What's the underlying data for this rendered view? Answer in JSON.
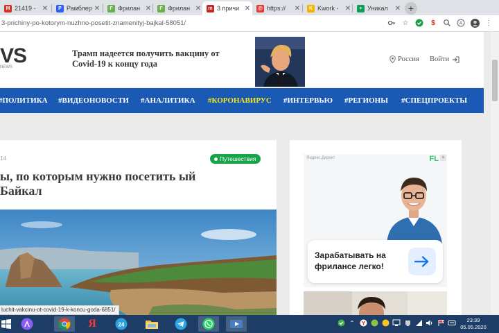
{
  "browser": {
    "tabs": [
      {
        "title": "21419 -",
        "favicon": "gmail-icon",
        "color": "#d93025",
        "active": false
      },
      {
        "title": "Рамблер",
        "favicon": "rambler-icon",
        "color": "#315efb",
        "active": false
      },
      {
        "title": "Фрилан",
        "favicon": "freelance-icon",
        "color": "#6ab04c",
        "active": false
      },
      {
        "title": "Фрилан",
        "favicon": "freelance-icon",
        "color": "#6ab04c",
        "active": false
      },
      {
        "title": "3 причи",
        "favicon": "news-icon",
        "color": "#c62828",
        "active": true
      },
      {
        "title": "https://",
        "favicon": "mail-icon",
        "color": "#e53935",
        "active": false
      },
      {
        "title": "Kwork -",
        "favicon": "kwork-icon",
        "color": "#f6b300",
        "active": false
      },
      {
        "title": "Уникал",
        "favicon": "sheets-icon",
        "color": "#0f9d58",
        "active": false
      }
    ],
    "new_tab": "+",
    "url": "3-prichiny-po-kotorym-nuzhno-posetit-znamenityj-bajkal-58051/"
  },
  "site": {
    "logo": "VS",
    "logo_sub": "NEWS",
    "header_news": "Трамп надеется получить вакцину от Covid-19 к концу года",
    "region": "Россия",
    "login": "Войти",
    "nav": [
      {
        "label": "#ПОЛИТИКА",
        "highlight": false
      },
      {
        "label": "#ВИДЕОНОВОСТИ",
        "highlight": false
      },
      {
        "label": "#АНАЛИТИКА",
        "highlight": false
      },
      {
        "label": "#КОРОНАВИРУС",
        "highlight": true
      },
      {
        "label": "#ИНТЕРВЬЮ",
        "highlight": false
      },
      {
        "label": "#РЕГИОНЫ",
        "highlight": false
      },
      {
        "label": "#СПЕЦПРОЕКТЫ",
        "highlight": false
      }
    ]
  },
  "article": {
    "date": "14",
    "category": "Путешествия",
    "title": "ы, по которым нужно посетить ый Байкал"
  },
  "ad": {
    "label": "Яндекс.Директ",
    "brand": "FL",
    "close": "×",
    "text": "Зарабатывать на фрилансе легко!"
  },
  "status_url": "luchit-vakcinu-ot-covid-19-k-koncu-goda-6851/",
  "taskbar": {
    "time": "23:39",
    "date": "05.05.2020",
    "yandex_label": "Я"
  },
  "colors": {
    "nav_bg": "#1a5ab5",
    "nav_highlight": "#f8e71c",
    "badge": "#16a34a",
    "taskbar": "#1d3d66"
  }
}
